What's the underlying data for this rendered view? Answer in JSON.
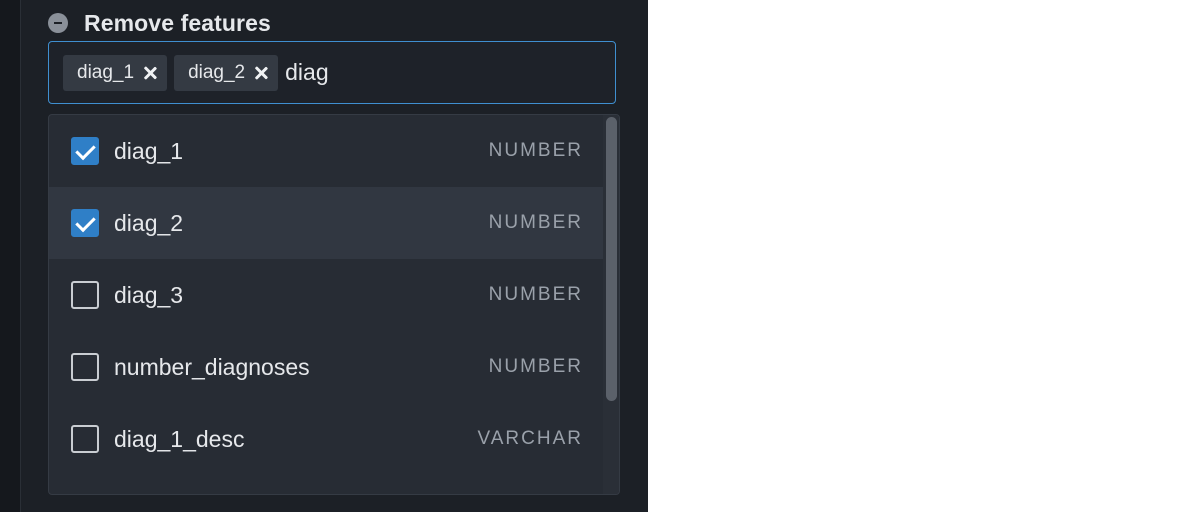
{
  "section": {
    "title": "Remove features",
    "icon": "minus-circle-icon"
  },
  "select": {
    "chips": [
      {
        "label": "diag_1"
      },
      {
        "label": "diag_2"
      }
    ],
    "search_value": "diag"
  },
  "options": [
    {
      "label": "diag_1",
      "type": "NUMBER",
      "checked": true
    },
    {
      "label": "diag_2",
      "type": "NUMBER",
      "checked": true
    },
    {
      "label": "diag_3",
      "type": "NUMBER",
      "checked": false
    },
    {
      "label": "number_diagnoses",
      "type": "NUMBER",
      "checked": false
    },
    {
      "label": "diag_1_desc",
      "type": "VARCHAR",
      "checked": false
    }
  ],
  "colors": {
    "accent": "#2f7fc7",
    "panel_bg": "#1c2026",
    "dropdown_bg": "#272c34",
    "focus_border": "#3f8fd0"
  }
}
